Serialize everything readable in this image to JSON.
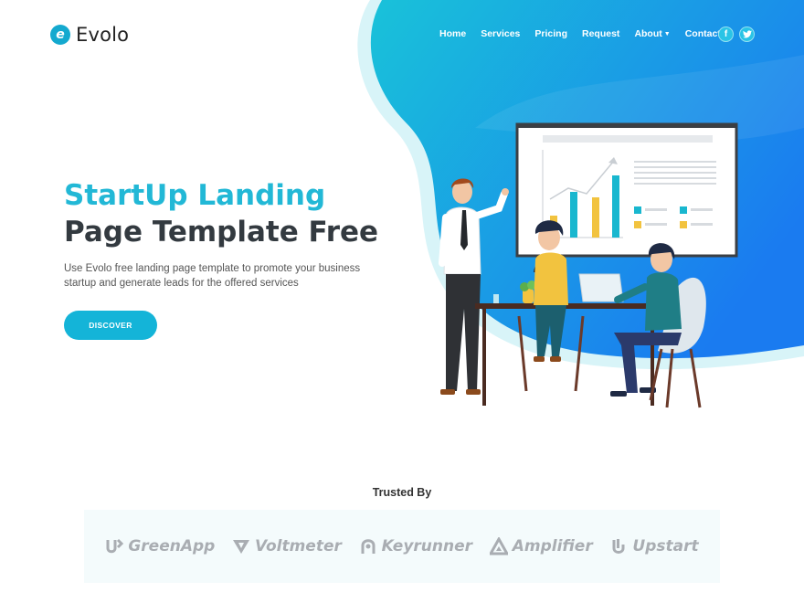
{
  "colors": {
    "accent": "#14b4d8",
    "title_accent": "#22b8d6",
    "title_dark": "#333a40",
    "brand_gray": "#a9adb2"
  },
  "header": {
    "logo_mark": "e",
    "logo_text": "Evolo",
    "menu": [
      {
        "label": "Home"
      },
      {
        "label": "Services"
      },
      {
        "label": "Pricing"
      },
      {
        "label": "Request"
      },
      {
        "label": "About",
        "dropdown": true
      },
      {
        "label": "Contact"
      }
    ],
    "social": [
      {
        "icon": "facebook-icon",
        "glyph": "f"
      },
      {
        "icon": "twitter-icon",
        "glyph": "t"
      }
    ]
  },
  "hero": {
    "title_line1": "StartUp Landing",
    "title_line2": "Page Template Free",
    "description": "Use Evolo free landing page template to promote your business startup and generate leads for the offered services",
    "cta_label": "DISCOVER"
  },
  "trusted": {
    "title": "Trusted By",
    "brands": [
      {
        "name": "GreenApp",
        "icon": "greenapp-logo-icon"
      },
      {
        "name": "Voltmeter",
        "icon": "voltmeter-logo-icon"
      },
      {
        "name": "Keyrunner",
        "icon": "keyrunner-logo-icon"
      },
      {
        "name": "Amplifier",
        "icon": "amplifier-logo-icon"
      },
      {
        "name": "Upstart",
        "icon": "upstart-logo-icon"
      }
    ]
  }
}
